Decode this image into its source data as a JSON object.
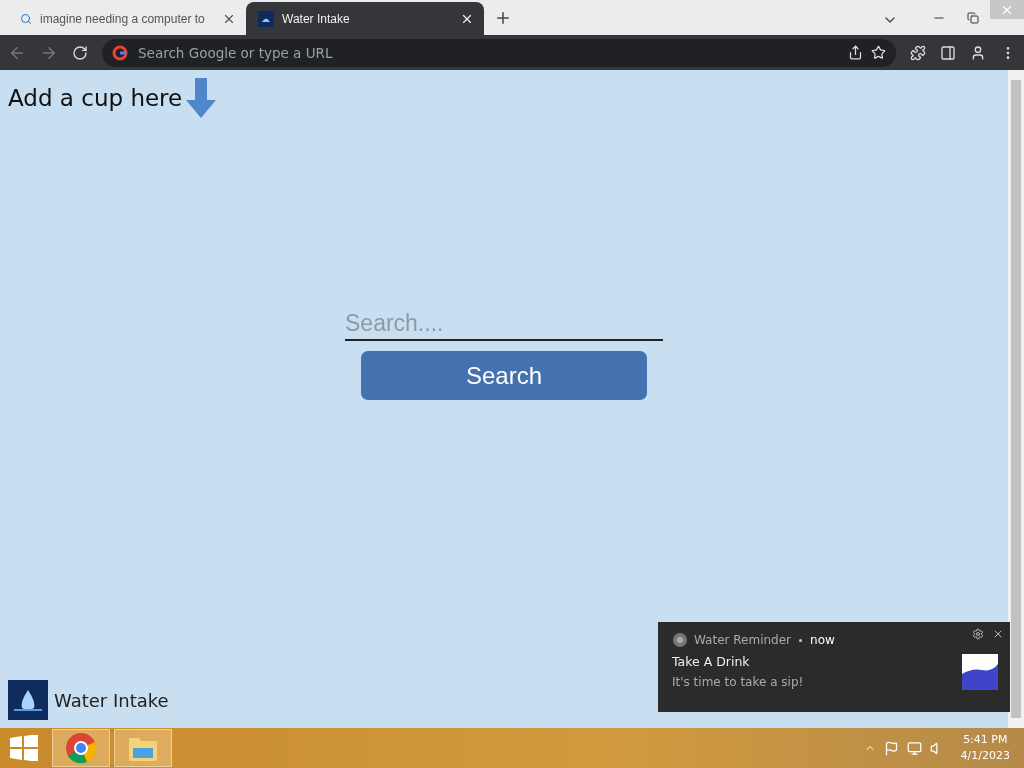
{
  "tabs": [
    {
      "title": "imagine needing a computer to",
      "selected": false
    },
    {
      "title": "Water Intake",
      "selected": true
    }
  ],
  "address_bar": {
    "placeholder": "Search Google or type a URL"
  },
  "page": {
    "heading": "Add a cup here",
    "search": {
      "placeholder": "Search....",
      "button": "Search"
    },
    "footer": {
      "brand": "Water Intake"
    }
  },
  "notification": {
    "app": "Water Reminder",
    "time": "now",
    "title": "Take A Drink",
    "body": "It's time to take a sip!"
  },
  "taskbar": {
    "time": "5:41 PM",
    "date": "4/1/2023"
  }
}
